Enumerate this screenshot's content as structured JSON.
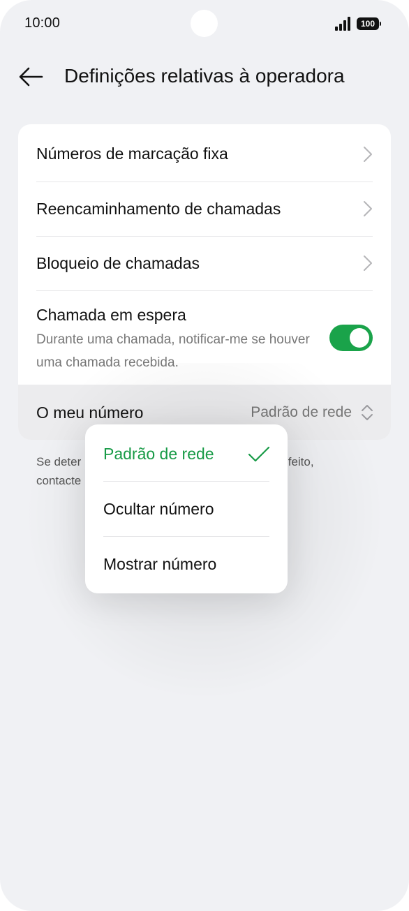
{
  "status_bar": {
    "time": "10:00",
    "battery": "100"
  },
  "header": {
    "title": "Definições relativas à operadora",
    "back_icon": "arrow-left-icon"
  },
  "settings": {
    "fixed_dialing": "Números de marcação fixa",
    "call_forwarding": "Reencaminhamento de chamadas",
    "call_barring": "Bloqueio de chamadas",
    "call_waiting": {
      "label": "Chamada em espera",
      "description": "Durante uma chamada, notificar-me se houver uma chamada recebida.",
      "enabled": true
    },
    "my_number": {
      "label": "O meu número",
      "value": "Padrão de rede"
    }
  },
  "footer_note": {
    "line1_start": "Se deter",
    "line1_end": "efeito,",
    "line2_start": "contacte"
  },
  "popup_menu": {
    "items": [
      {
        "label": "Padrão de rede",
        "selected": true
      },
      {
        "label": "Ocultar número",
        "selected": false
      },
      {
        "label": "Mostrar número",
        "selected": false
      }
    ]
  },
  "colors": {
    "accent": "#179a46",
    "toggle_on": "#1aa34a",
    "background": "#f0f1f4"
  }
}
